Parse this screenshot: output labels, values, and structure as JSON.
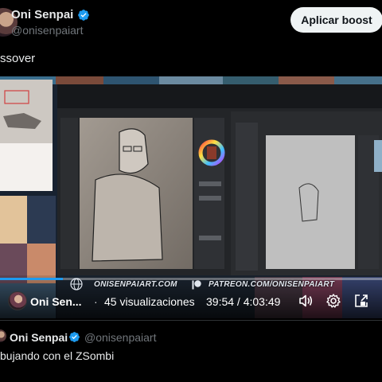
{
  "post": {
    "author_name": "Oni Senpai",
    "author_handle": "@onisenpaiart",
    "boost_button_label": "Aplicar boost",
    "text": "ssover"
  },
  "video": {
    "watermark_site": "ONISENPAIART.COM",
    "watermark_patreon": "PATREON.COM/ONISENPAIART",
    "channel_name": "Oni Sen...",
    "separator": "·",
    "views": "45 visualizaciones",
    "time": "39:54 / 4:03:49",
    "progress_fraction": 0.164,
    "icons": [
      "volume-icon",
      "settings-gear-icon",
      "popout-icon"
    ]
  },
  "quoted_post": {
    "author_name": "Oni Senpai",
    "author_handle": "@onisenpaiart",
    "text": "bujando con el ZSombi"
  },
  "colors": {
    "accent": "#1d9bf0",
    "background": "#000000",
    "secondary_text": "#71767b",
    "button_bg": "#eff3f4"
  }
}
